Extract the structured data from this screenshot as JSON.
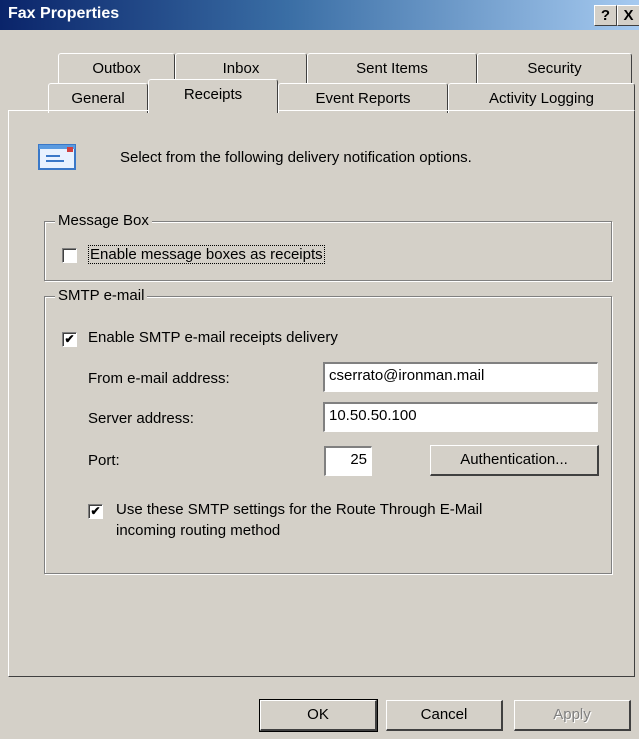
{
  "window": {
    "title": "Fax Properties",
    "help_label": "?",
    "close_label": "X"
  },
  "tabs_back": [
    "Outbox",
    "Inbox",
    "Sent Items",
    "Security"
  ],
  "tabs_front": [
    "General",
    "Receipts",
    "Event Reports",
    "Activity Logging"
  ],
  "active_tab": "Receipts",
  "intro": {
    "icon": "envelope-icon",
    "text": "Select from the following delivery notification options."
  },
  "message_box": {
    "legend": "Message Box",
    "checkbox_label": "Enable message boxes as receipts",
    "checked": false
  },
  "smtp": {
    "legend": "SMTP e-mail",
    "enable_label": "Enable SMTP e-mail receipts delivery",
    "enable_checked": true,
    "from_label": "From e-mail address:",
    "from_value": "cserrato@ironman.mail",
    "server_label": "Server address:",
    "server_value": "10.50.50.100",
    "port_label": "Port:",
    "port_value": "25",
    "auth_button": "Authentication...",
    "route_label_line1": "Use these SMTP settings for the Route Through E-Mail",
    "route_label_line2": "incoming routing method",
    "route_checked": true
  },
  "buttons": {
    "ok": "OK",
    "cancel": "Cancel",
    "apply": "Apply"
  }
}
